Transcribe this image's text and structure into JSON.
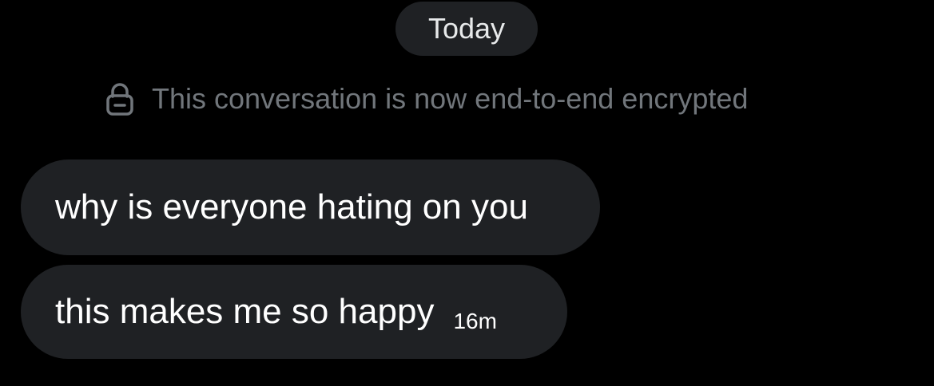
{
  "date_separator": {
    "label": "Today"
  },
  "encryption": {
    "icon": "lock-icon",
    "text": "This conversation is now end-to-end encrypted"
  },
  "messages": [
    {
      "text": "why is everyone hating on you",
      "time": ""
    },
    {
      "text": "this makes me so happy",
      "time": "16m"
    }
  ],
  "colors": {
    "background": "#000000",
    "bubble": "#1f2124",
    "muted_text": "#71767b",
    "text": "#ffffff"
  }
}
